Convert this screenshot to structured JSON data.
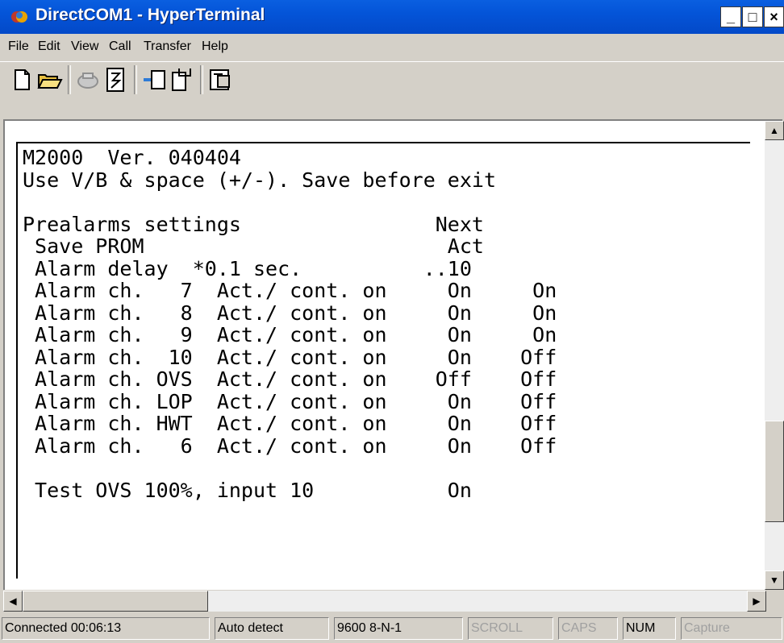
{
  "window": {
    "title": "DirectCOM1 - HyperTerminal",
    "buttons": {
      "minimize": "_",
      "maximize": "□",
      "close": "×"
    }
  },
  "menubar": [
    {
      "label": "File"
    },
    {
      "label": "Edit"
    },
    {
      "label": "View"
    },
    {
      "label": "Call"
    },
    {
      "label": "Transfer"
    },
    {
      "label": "Help"
    }
  ],
  "toolbar": [
    "new-icon",
    "open-icon",
    "disconnect-icon",
    "dial-icon",
    "send-icon",
    "receive-icon",
    "properties-icon"
  ],
  "terminal": {
    "lines": [
      "M2000  Ver. 040404",
      "Use V/B & space (+/-). Save before exit",
      "",
      "Prealarms settings                Next",
      " Save PROM                         Act",
      " Alarm delay  *0.1 sec.          ..10",
      " Alarm ch.   7  Act./ cont. on     On     On",
      " Alarm ch.   8  Act./ cont. on     On     On",
      " Alarm ch.   9  Act./ cont. on     On     On",
      " Alarm ch.  10  Act./ cont. on     On    Off",
      " Alarm ch. OVS  Act./ cont. on    Off    Off",
      " Alarm ch. LOP  Act./ cont. on     On    Off",
      " Alarm ch. HWT  Act./ cont. on     On    Off",
      " Alarm ch.   6  Act./ cont. on     On    Off",
      "",
      " Test OVS 100%, input 10           On"
    ]
  },
  "statusbar": [
    {
      "label": "Connected 00:06:13",
      "active": true
    },
    {
      "label": "Auto detect",
      "active": true
    },
    {
      "label": "9600 8-N-1",
      "active": true
    },
    {
      "label": "SCROLL",
      "active": false
    },
    {
      "label": "CAPS",
      "active": false
    },
    {
      "label": "NUM",
      "active": true
    },
    {
      "label": "Capture",
      "active": false
    }
  ]
}
